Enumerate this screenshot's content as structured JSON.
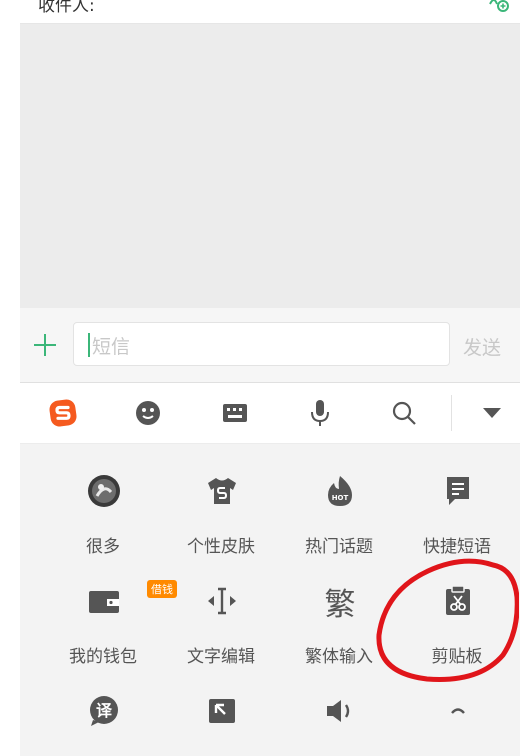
{
  "header": {
    "recipient_label": "收件人:"
  },
  "composer": {
    "sms_placeholder": "短信",
    "send_label": "发送"
  },
  "ime": {
    "toolbar": [
      "sogou-logo",
      "emoji",
      "keyboard",
      "voice",
      "search",
      "collapse"
    ],
    "features": [
      {
        "label": "很多",
        "icon": "avatar"
      },
      {
        "label": "个性皮肤",
        "icon": "tshirt"
      },
      {
        "label": "热门话题",
        "icon": "hot"
      },
      {
        "label": "快捷短语",
        "icon": "quick-phrase"
      },
      {
        "label": "我的钱包",
        "icon": "wallet",
        "badge": "借钱"
      },
      {
        "label": "文字编辑",
        "icon": "text-cursor"
      },
      {
        "label": "繁体输入",
        "icon": "traditional-char",
        "glyph": "繁"
      },
      {
        "label": "剪贴板",
        "icon": "clipboard"
      },
      {
        "label": "",
        "icon": "translate",
        "glyph": "译"
      },
      {
        "label": "",
        "icon": "resize"
      },
      {
        "label": "",
        "icon": "speaker"
      },
      {
        "label": "",
        "icon": "arc"
      }
    ]
  },
  "colors": {
    "accent_green": "#3bb679",
    "sogou_orange": "#f55a1f",
    "annotation_red": "#e0151a"
  }
}
